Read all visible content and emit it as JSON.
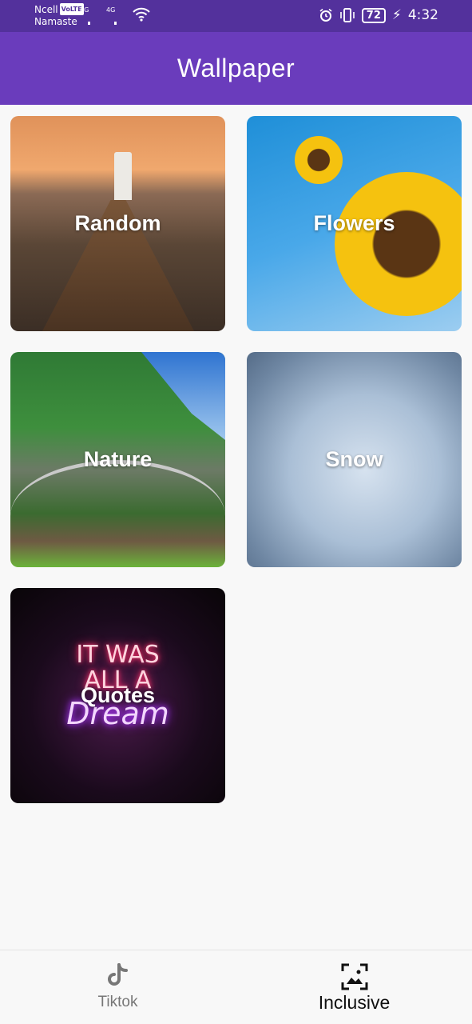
{
  "status_bar": {
    "carrier_1": "Ncell",
    "volte_badge": "VoLTE",
    "carrier_2": "Namaste",
    "network_1": "4G",
    "network_2": "4G",
    "battery": "72",
    "time": "4:32"
  },
  "app_bar": {
    "title": "Wallpaper"
  },
  "categories": [
    {
      "label": "Random"
    },
    {
      "label": "Flowers"
    },
    {
      "label": "Nature"
    },
    {
      "label": "Snow"
    },
    {
      "label": "Quotes"
    }
  ],
  "quote_art": {
    "line1": "IT WAS",
    "line2": "ALL A",
    "line3": "Dream"
  },
  "bottom_nav": {
    "items": [
      {
        "label": "Tiktok",
        "icon": "tiktok-icon",
        "selected": false
      },
      {
        "label": "Inclusive",
        "icon": "wallpaper-icon",
        "selected": true
      }
    ]
  },
  "colors": {
    "status_bar": "#53319c",
    "app_bar": "#6a3cbc",
    "background": "#f8f8f8"
  }
}
